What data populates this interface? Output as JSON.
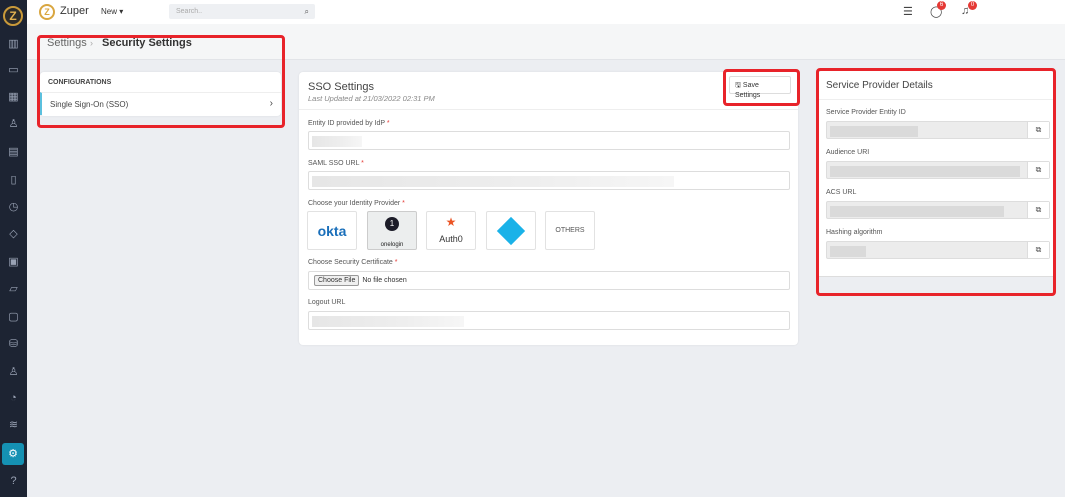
{
  "app": {
    "brand": "Zuper",
    "new_label": "New ▾",
    "search_placeholder": "Search..",
    "chat_badge": "6",
    "notif_badge": "0"
  },
  "breadcrumb": {
    "parent": "Settings",
    "current": "Security Settings"
  },
  "configurations": {
    "title": "CONFIGURATIONS",
    "item": "Single Sign-On (SSO)"
  },
  "sso": {
    "title": "SSO Settings",
    "last_updated": "Last Updated at 21/03/2022 02:31 PM",
    "save_label": "Save Settings",
    "entity_label": "Entity ID provided by IdP",
    "saml_label": "SAML SSO URL",
    "idp_label": "Choose your Identity Provider",
    "providers": [
      "okta",
      "onelogin",
      "Auth0",
      "Azure AD",
      "OTHERS"
    ],
    "cert_label": "Choose Security Certificate",
    "choose_file": "Choose File",
    "no_file": "No file chosen",
    "logout_label": "Logout URL",
    "required": "*"
  },
  "service_provider": {
    "title": "Service Provider Details",
    "fields": [
      "Service Provider Entity ID",
      "Audience URI",
      "ACS URL",
      "Hashing algorithm"
    ]
  },
  "colors": {
    "sidebar": "#1d2433",
    "accent": "#1591b3",
    "highlight": "#e8232a"
  }
}
